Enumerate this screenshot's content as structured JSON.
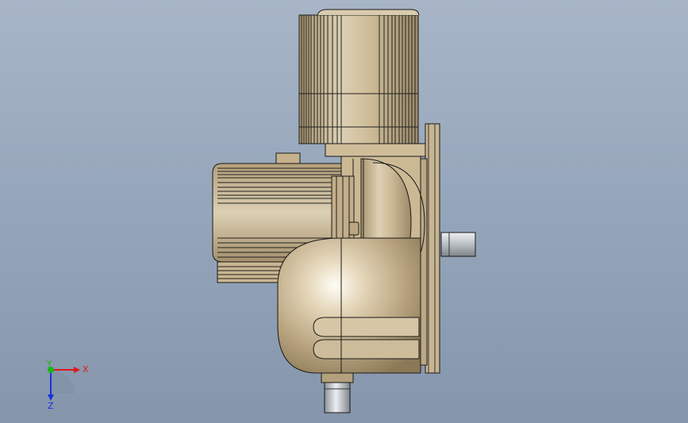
{
  "viewport": {
    "background_top": "#a7b5c7",
    "background_bottom": "#8595ab"
  },
  "model": {
    "body_color": "#d8c7a6",
    "body_shadow": "#9c8a68",
    "edge_color": "#1a1a1a",
    "shaft_color": "#c9ced4"
  },
  "triad": {
    "x_label": "X",
    "y_label": "Y",
    "z_label": "Z",
    "x_color": "#e01818",
    "y_color": "#18b818",
    "z_color": "#1830d8"
  }
}
